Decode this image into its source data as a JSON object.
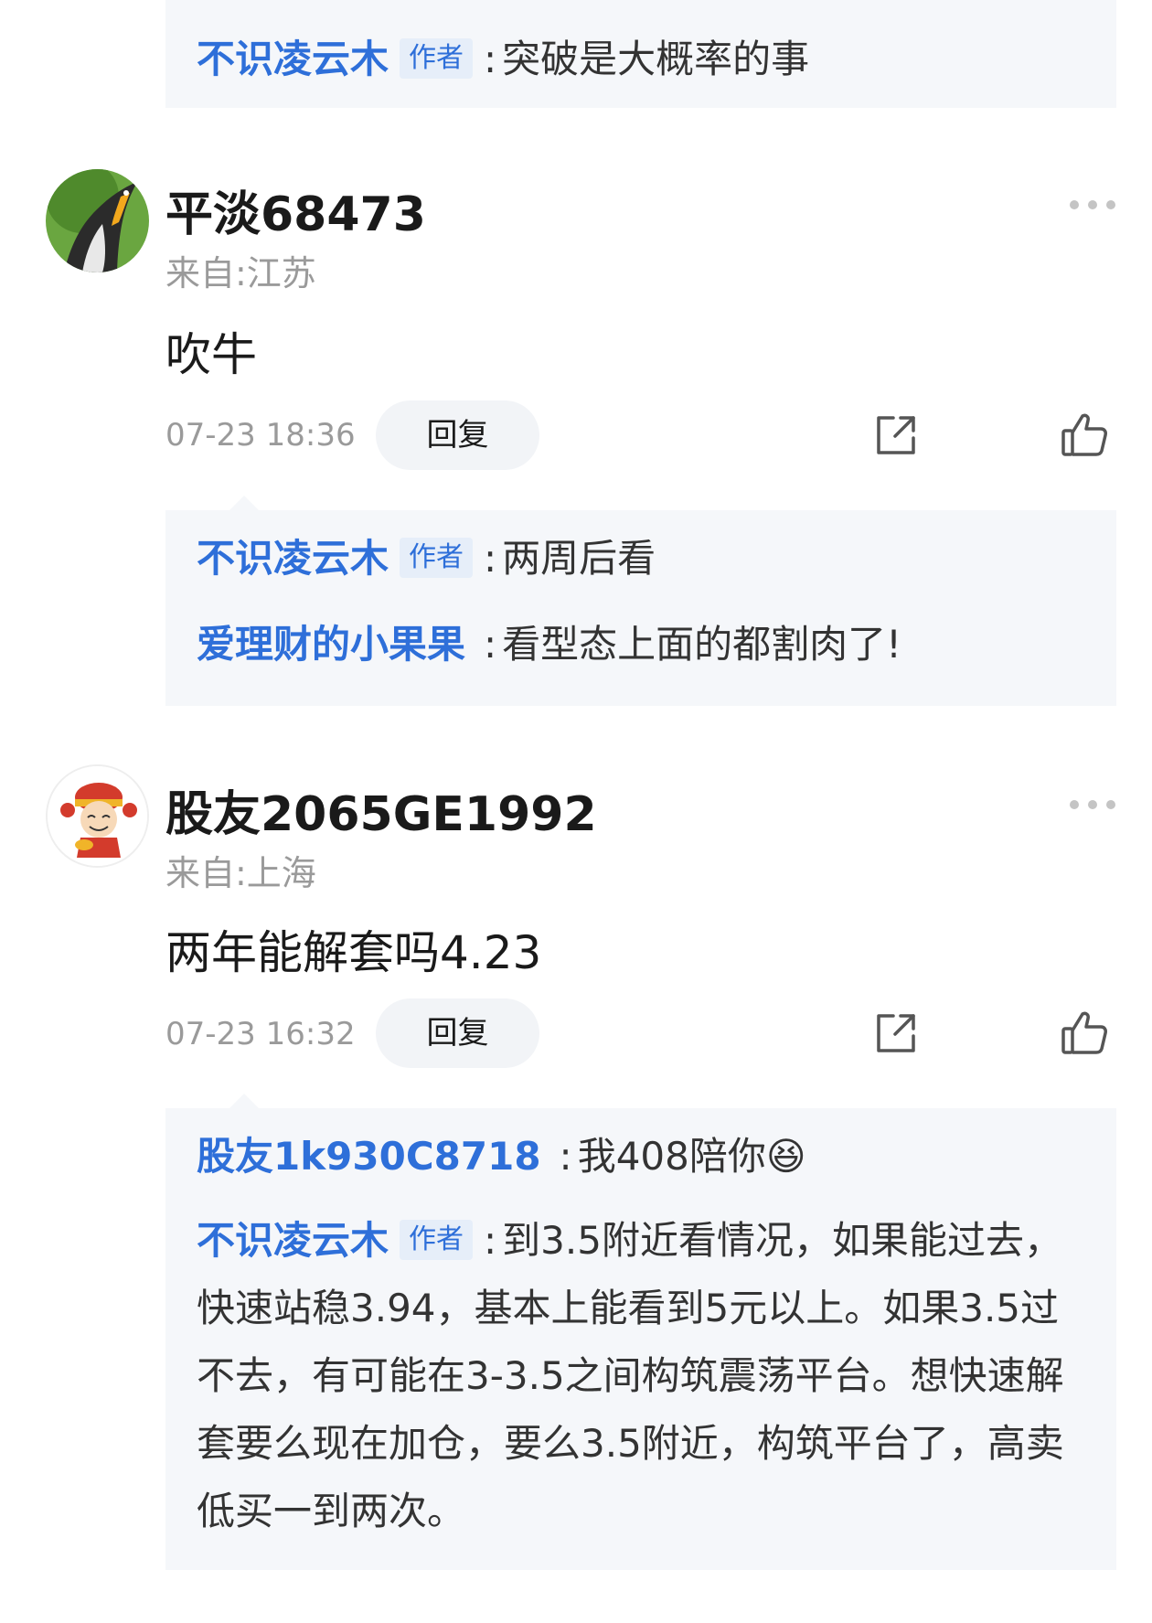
{
  "top_reply": {
    "name": "不识凌云木",
    "tag": "作者",
    "text": "突破是大概率的事"
  },
  "comments": [
    {
      "username": "平淡68473",
      "location": "来自:江苏",
      "body": "吹牛",
      "time": "07-23 18:36",
      "reply_label": "回复",
      "avatar_icon": "penguin-avatar",
      "replies": [
        {
          "name": "不识凌云木",
          "tag": "作者",
          "text": "两周后看"
        },
        {
          "name": "爱理财的小果果",
          "tag": "",
          "text": "看型态上面的都割肉了!"
        }
      ]
    },
    {
      "username": "股友2065GE1992",
      "location": "来自:上海",
      "body": "两年能解套吗4.23",
      "time": "07-23 16:32",
      "reply_label": "回复",
      "avatar_icon": "fortune-god-avatar",
      "replies": [
        {
          "name": "股友1k930C8718",
          "tag": "",
          "text": "我408陪你",
          "emoji": "😆"
        },
        {
          "name": "不识凌云木",
          "tag": "作者",
          "text": "到3.5附近看情况，如果能过去，快速站稳3.94，基本上能看到5元以上。如果3.5过不去，有可能在3-3.5之间构筑震荡平台。想快速解套要么现在加仓，要么3.5附近，构筑平台了，高卖低买一到两次。"
        }
      ]
    }
  ],
  "colors": {
    "link_blue": "#2e6fd9",
    "reply_bg": "#f5f7fa",
    "muted": "#9a9a9a"
  }
}
